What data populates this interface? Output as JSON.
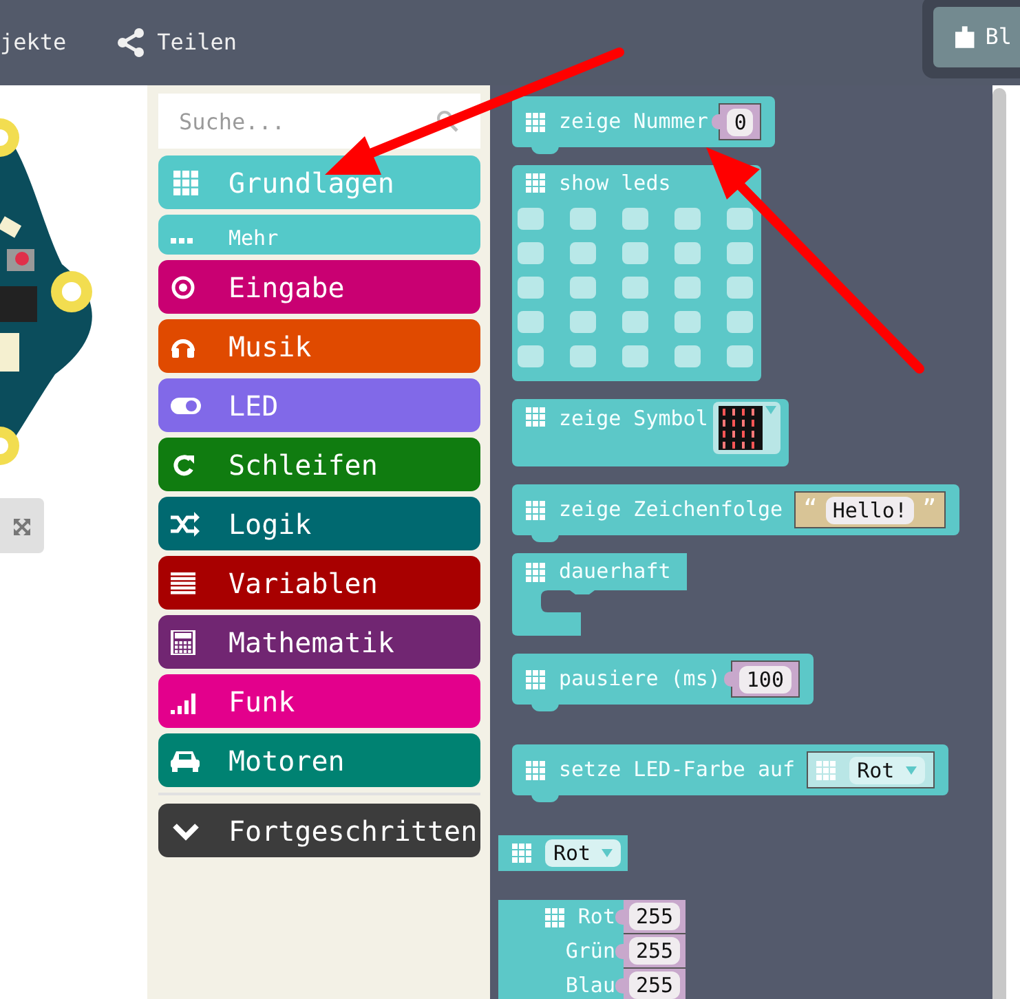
{
  "top_bar": {
    "links": [
      {
        "label": "jekte"
      },
      {
        "label": "Teilen"
      }
    ],
    "editor_tab": {
      "label": "Bl"
    }
  },
  "toolbox": {
    "search": {
      "placeholder": "Suche..."
    },
    "categories": [
      {
        "label": "Grundlagen",
        "kind": "category",
        "color": "#54c9c9"
      },
      {
        "label": "Mehr",
        "kind": "sub",
        "color": "#54c9c9"
      },
      {
        "label": "Eingabe",
        "kind": "category",
        "color": "#c90072"
      },
      {
        "label": "Musik",
        "kind": "category",
        "color": "#e04a00"
      },
      {
        "label": "LED",
        "kind": "category",
        "color": "#8169e8"
      },
      {
        "label": "Schleifen",
        "kind": "category",
        "color": "#107c10"
      },
      {
        "label": "Logik",
        "kind": "category",
        "color": "#006970"
      },
      {
        "label": "Variablen",
        "kind": "category",
        "color": "#a80000"
      },
      {
        "label": "Mathematik",
        "kind": "category",
        "color": "#712672"
      },
      {
        "label": "Funk",
        "kind": "category",
        "color": "#e3008c"
      },
      {
        "label": "Motoren",
        "kind": "category",
        "color": "#008272"
      },
      {
        "label": "Fortgeschritten",
        "kind": "toggle",
        "color": "#3c3c3c",
        "expanded": false
      }
    ]
  },
  "blocks": [
    {
      "kind": "statement",
      "label": "zeige Nummer",
      "input": {
        "kind": "number",
        "value": "0"
      }
    },
    {
      "kind": "leds",
      "label": "show leds"
    },
    {
      "kind": "symbol",
      "label": "zeige Symbol"
    },
    {
      "kind": "statement",
      "label": "zeige Zeichenfolge",
      "input": {
        "kind": "string",
        "open": "“",
        "value": "Hello!",
        "close": "”"
      }
    },
    {
      "kind": "loop",
      "label": "dauerhaft"
    },
    {
      "kind": "statement",
      "label": "pausiere (ms)",
      "input": {
        "kind": "number",
        "value": "100"
      }
    },
    {
      "kind": "statement",
      "label": "setze LED-Farbe auf",
      "input": {
        "kind": "color",
        "value": "Rot"
      }
    },
    {
      "kind": "reporter",
      "value": "Rot"
    },
    {
      "kind": "rgb",
      "fields": [
        {
          "label": "Rot",
          "value": "255"
        },
        {
          "label": "Grün",
          "value": "255"
        },
        {
          "label": "Blau",
          "value": "255"
        }
      ]
    }
  ]
}
